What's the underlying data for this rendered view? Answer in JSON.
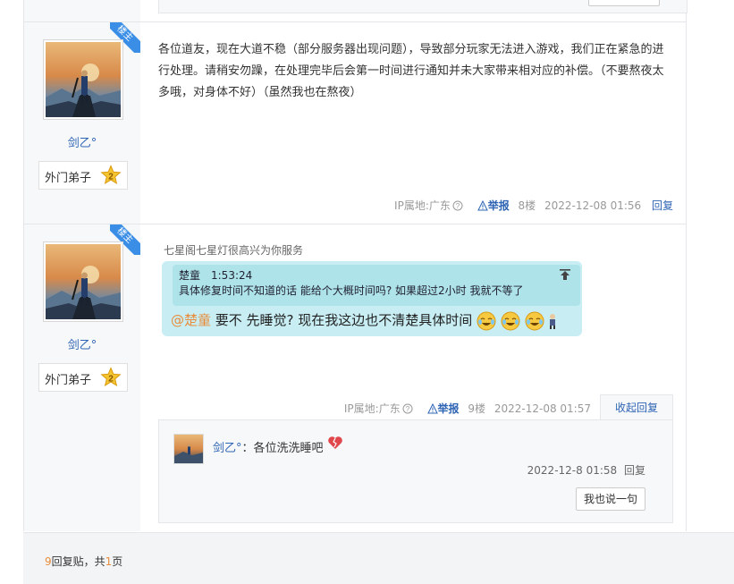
{
  "posts": [
    {
      "badge": "楼主",
      "username": "剑乙°",
      "rank": "外门弟子",
      "content": "各位道友，现在大道不稳（部分服务器出现问题），导致部分玩家无法进入游戏，我们正在紧急的进行处理。请稍安勿躁，在处理完毕后会第一时间进行通知并未大家带来相对应的补偿。（不要熬夜太多哦，对身体不好）（虽然我也在熬夜）",
      "ip": "IP属地:广东",
      "report": "举报",
      "floor": "8楼",
      "time": "2022-12-08 01:56",
      "reply": "回复"
    },
    {
      "badge": "楼主",
      "username": "剑乙°",
      "rank": "外门弟子",
      "intro": "七星阁七星灯很高兴为你服务",
      "quote_head": "楚童　1:53:24",
      "quote_text": "具体修复时间不知道的话 能给个大概时间吗? 如果超过2小时 我就不等了",
      "mention": "@楚童",
      "message": " 要不 先睡觉?  现在我这边也不清楚具体时间",
      "ip": "IP属地:广东",
      "report": "举报",
      "floor": "9楼",
      "time": "2022-12-08 01:57",
      "collapse": "收起回复",
      "subreply": {
        "username": "剑乙°",
        "text": "：各位洗洗睡吧",
        "time": "2022-12-8 01:58",
        "reply": "回复",
        "say_button": "我也说一句"
      }
    }
  ],
  "footer": {
    "count": "9",
    "count_label": "回复贴，共",
    "pages": "1",
    "pages_label": "页"
  },
  "colors": {
    "link": "#2d64b3",
    "ribbon": "#3a8ee6",
    "mention": "#e88d3d",
    "chat_bg": "#c8eef4"
  }
}
